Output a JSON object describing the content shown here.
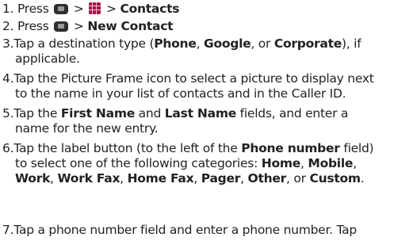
{
  "steps": [
    {
      "num": "1.",
      "press": "Press",
      "gt1": ">",
      "gt2": ">",
      "target": "Contacts"
    },
    {
      "num": "2.",
      "press": "Press",
      "gt1": ">",
      "target": "New Contact"
    },
    {
      "num": "3.",
      "line1_pre": "Tap a destination type (",
      "phone": "Phone",
      "c1": ", ",
      "google": "Google",
      "c2": ", or ",
      "corporate": "Corporate",
      "line1_post": "), if",
      "line2": "applicable."
    },
    {
      "num": "4.",
      "line1": "Tap the Picture Frame icon to select a picture to display next",
      "line2": "to the name in your list of contacts and in the Caller ID."
    },
    {
      "num": "5.",
      "pre": "Tap the ",
      "first": "First Name",
      "and": " and ",
      "last": "Last Name",
      "post": " fields, and enter a",
      "line2": "name for the new entry."
    },
    {
      "num": "6.",
      "l1_pre": "Tap the label button (to the left of the ",
      "phone_number": "Phone number",
      "l1_post": " field)",
      "l2_pre": "to select one of the following categories: ",
      "home": "Home",
      "sep1": ", ",
      "mobile": "Mobile",
      "sep2": ",",
      "work": "Work",
      "sep3": ", ",
      "work_fax": "Work Fax",
      "sep4": ", ",
      "home_fax": "Home Fax",
      "sep5": ", ",
      "pager": "Pager",
      "sep6": ", ",
      "other": "Other",
      "sep7": ", or ",
      "custom": "Custom",
      "end": "."
    },
    {
      "num": "7.",
      "line1": "Tap a phone number field and enter a phone number. Tap"
    }
  ],
  "icons": {
    "home_key": "home-key-icon",
    "apps_grid": "apps-grid-icon",
    "menu_key": "menu-key-icon"
  }
}
